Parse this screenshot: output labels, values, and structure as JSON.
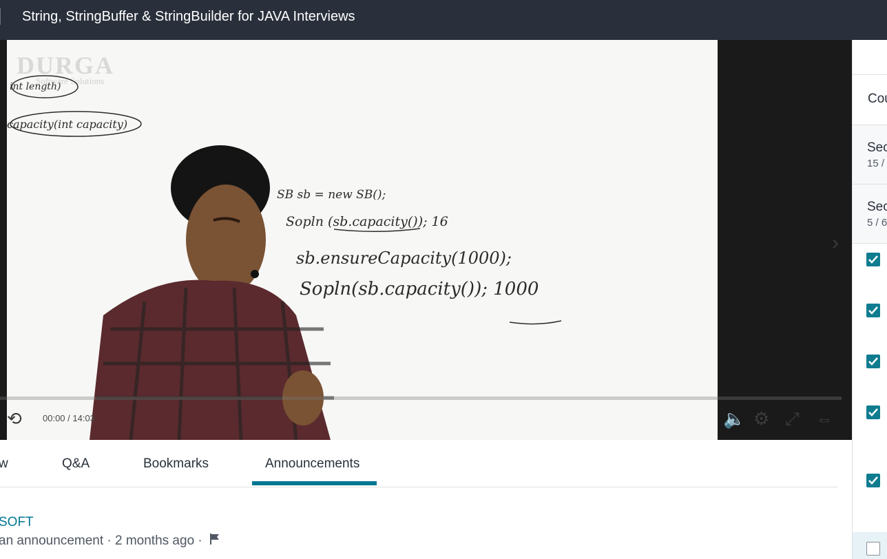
{
  "header": {
    "title": "String, StringBuffer & StringBuilder for JAVA Interviews"
  },
  "video": {
    "watermark": "DURGA",
    "watermark_sub": "Software Solutions",
    "board_text": [
      "int length)",
      "capacity(int capacity)",
      "SB  sb = new SB();",
      "Sopln (sb.capacity()); 16",
      "sb.ensureCapacity(1000);",
      "Sopln(sb.capacity()); 1000"
    ],
    "time_display": "00:00 / 14:03",
    "progress_fraction": 0.0
  },
  "tabs": [
    {
      "label": "w"
    },
    {
      "label": "Q&A"
    },
    {
      "label": "Bookmarks"
    },
    {
      "label": "Announcements",
      "active": true
    }
  ],
  "announcement": {
    "author": "SOFT",
    "meta": "an announcement · 2 months ago ·"
  },
  "sidebar": {
    "heading": "Cou",
    "sections": [
      {
        "title": "Sec",
        "count": "15 /"
      },
      {
        "title": "Sec",
        "count": "5 / 6"
      }
    ],
    "items_checked": [
      true,
      true,
      true,
      true,
      true,
      false
    ]
  },
  "colors": {
    "accent": "#007791",
    "topbar": "#29303b",
    "checkbox": "#0f7c90"
  }
}
